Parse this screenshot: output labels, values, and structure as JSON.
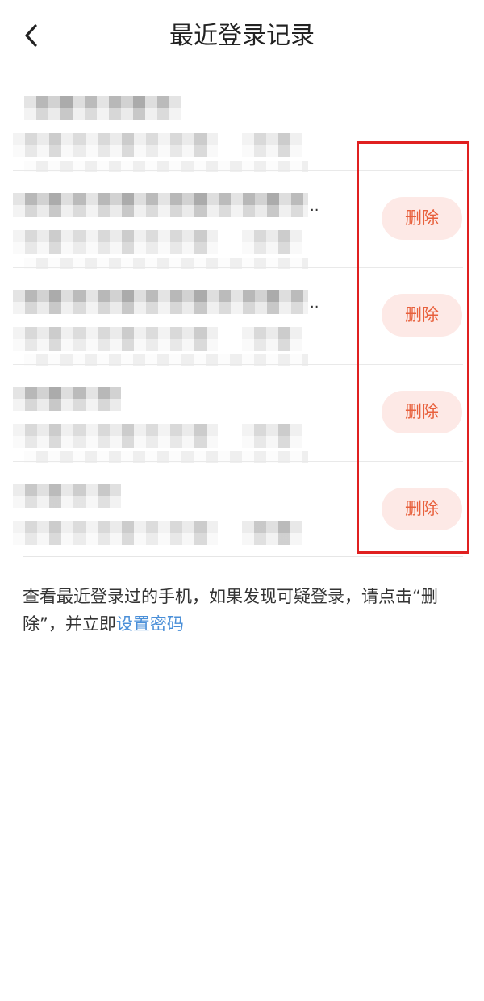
{
  "header": {
    "title": "最近登录记录",
    "back_icon": "chevron-left-icon"
  },
  "records": [
    {
      "has_delete": false
    },
    {
      "has_delete": true,
      "delete_label": "删除",
      "name_truncated": ".."
    },
    {
      "has_delete": true,
      "delete_label": "删除",
      "name_truncated": ".."
    },
    {
      "has_delete": true,
      "delete_label": "删除"
    },
    {
      "has_delete": true,
      "delete_label": "删除"
    }
  ],
  "footer": {
    "hint_text": "查看最近登录过的手机，如果发现可疑登录，请点击“删除”，并立即",
    "hint_link": "设置密码"
  },
  "colors": {
    "delete_text": "#e8603c",
    "delete_bg": "#fde9e6",
    "highlight_border": "#e02020",
    "link": "#4a8fd8"
  }
}
